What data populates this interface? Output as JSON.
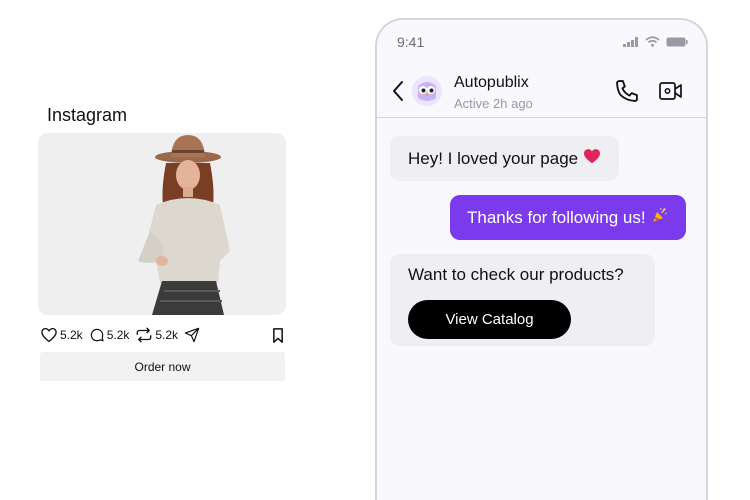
{
  "instagram": {
    "title": "Instagram",
    "likes": "5.2k",
    "comments": "5.2k",
    "reposts": "5.2k",
    "order_label": "Order now"
  },
  "phone": {
    "time": "9:41",
    "contact_name": "Autopublix",
    "contact_status": "Active 2h ago",
    "messages": [
      {
        "from": "contact",
        "text": "Hey! I loved your page"
      },
      {
        "from": "user",
        "text": "Thanks for following us!"
      },
      {
        "from": "contact",
        "text": "Want to check our products?",
        "button": "View Catalog"
      }
    ]
  },
  "colors": {
    "accent": "#7c3aed",
    "phone_bg": "#f9f8fd",
    "incoming_bubble": "#efeef3"
  },
  "icons": [
    "heart-icon",
    "comment-icon",
    "repost-icon",
    "send-icon",
    "bookmark-icon",
    "back-icon",
    "phone-icon",
    "video-icon",
    "signal-icon",
    "wifi-icon",
    "battery-icon",
    "heart-emoji",
    "party-popper-emoji"
  ]
}
